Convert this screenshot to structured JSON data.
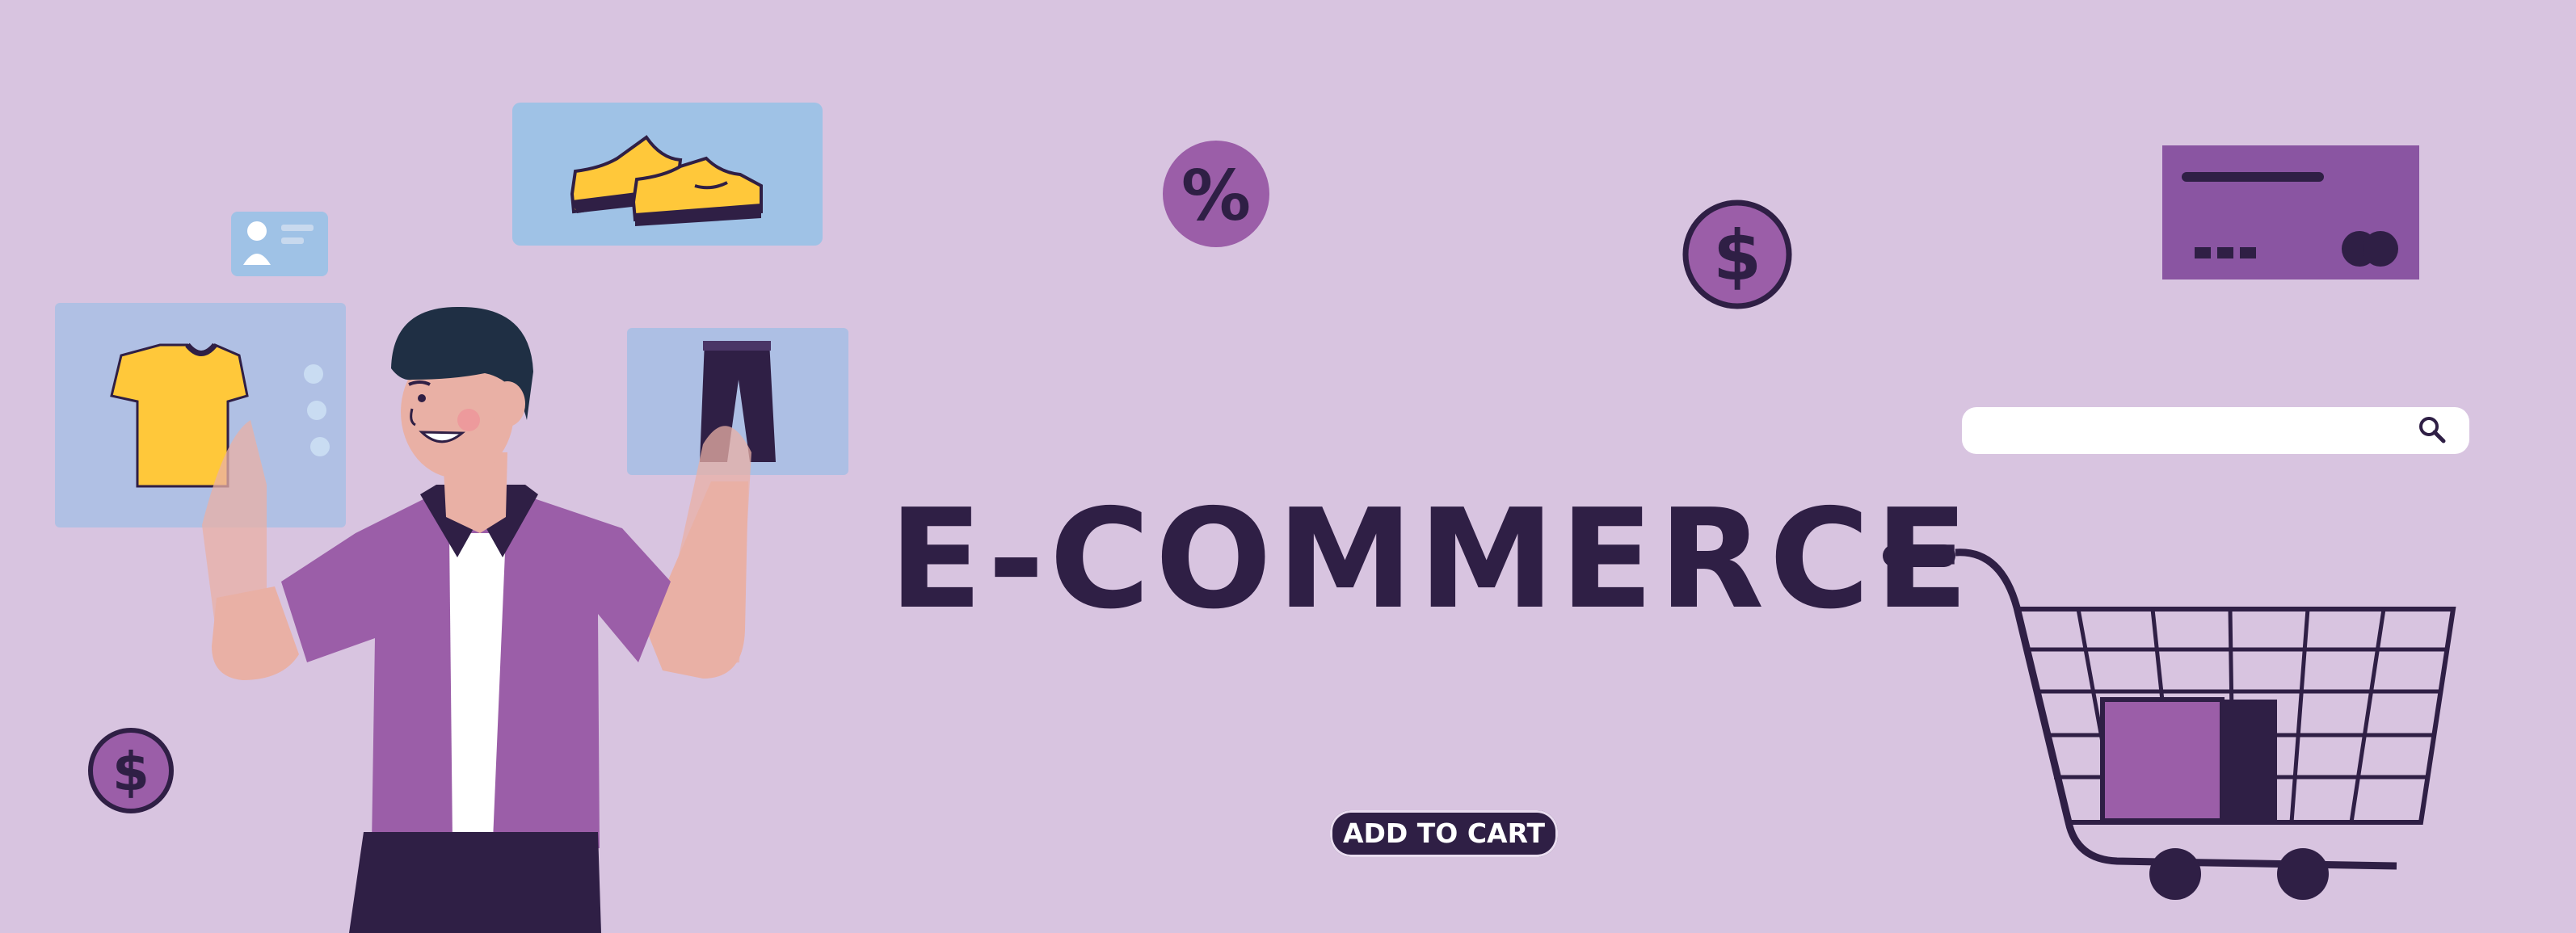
{
  "banner": {
    "title": "E-COMMERCE",
    "add_to_cart_label": "ADD TO CART",
    "percent_symbol": "%",
    "currency_symbol": "$"
  },
  "search": {
    "value": "",
    "placeholder": ""
  },
  "icons": {
    "discount": "percent-icon",
    "currency": "dollar-icon",
    "search": "search-icon",
    "payment": "credit-card-icon",
    "cart": "shopping-cart-icon",
    "profile": "user-profile-icon"
  },
  "products": [
    "t-shirt",
    "sneakers",
    "trousers"
  ],
  "colors": {
    "background": "#d8c4e0",
    "ink": "#2f1f45",
    "purple": "#9b5ea8",
    "card_purple": "#8a55a2",
    "panel_blue": "#9fc2e6",
    "yellow": "#ffc83a",
    "skin": "#e9b0a5"
  }
}
